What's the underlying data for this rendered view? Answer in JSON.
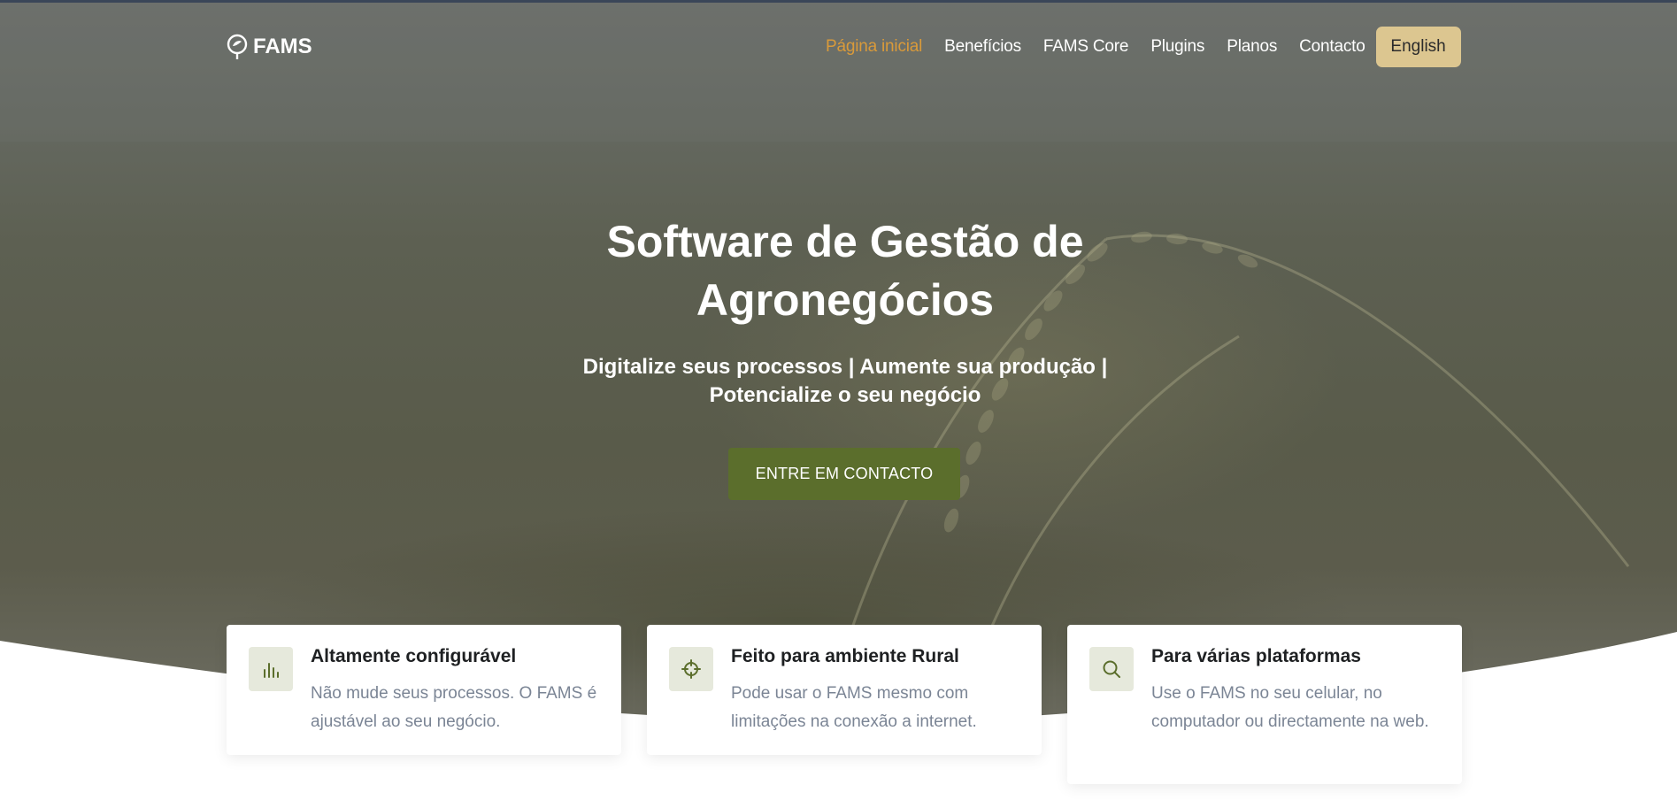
{
  "brand": {
    "name": "FAMS",
    "logo_icon": "leaf-pin-icon"
  },
  "nav": {
    "items": [
      {
        "label": "Página inicial",
        "active": true
      },
      {
        "label": "Benefícios",
        "active": false
      },
      {
        "label": "FAMS Core",
        "active": false
      },
      {
        "label": "Plugins",
        "active": false
      },
      {
        "label": "Planos",
        "active": false
      },
      {
        "label": "Contacto",
        "active": false
      }
    ],
    "language_button": "English"
  },
  "hero": {
    "title_line1": "Software de Gestão de",
    "title_line2": "Agronegócios",
    "subtitle_line1": "Digitalize seus processos | Aumente sua produção |",
    "subtitle_line2": "Potencialize o seu negócio",
    "cta_label": "ENTRE EM CONTACTO"
  },
  "features": [
    {
      "icon": "bar-chart-icon",
      "title": "Altamente configurável",
      "text": "Não mude seus processos. O FAMS é ajustável ao seu negócio."
    },
    {
      "icon": "crosshair-icon",
      "title": "Feito para ambiente Rural",
      "text": "Pode usar o FAMS mesmo com limitações na conexão a internet."
    },
    {
      "icon": "search-icon",
      "title": "Para várias plataformas",
      "text": "Use o FAMS no seu celular, no computador ou directamente na web."
    }
  ],
  "colors": {
    "accent_active_nav": "#d99a3a",
    "language_button_bg": "#dcc690",
    "cta_bg": "#5b6e2c",
    "icon_box_bg": "#e6e9dc",
    "icon_color": "#5b6e2c"
  }
}
